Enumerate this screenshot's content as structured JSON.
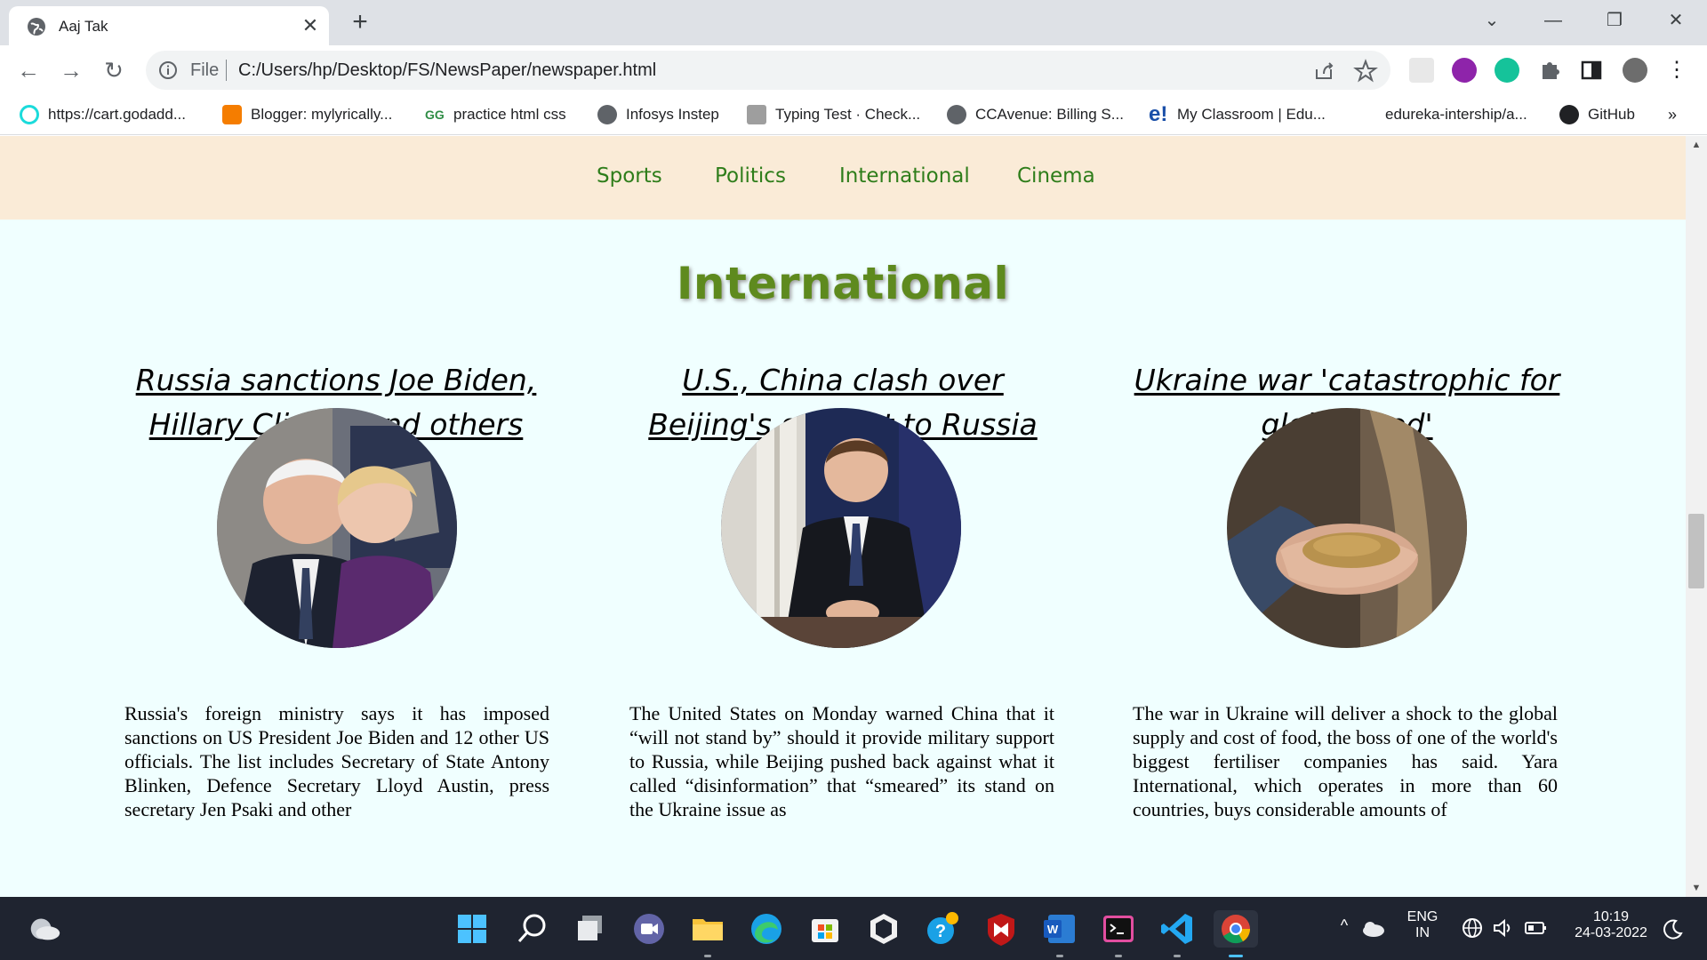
{
  "browser": {
    "tab_title": "Aaj Tak",
    "new_tab_symbol": "+",
    "tab_close_symbol": "✕",
    "scheme_label": "File",
    "url": "C:/Users/hp/Desktop/FS/NewsPaper/newspaper.html",
    "bookmarks": [
      {
        "label": "https://cart.godadd...",
        "icon": "godaddy-icon"
      },
      {
        "label": "Blogger: mylyrically...",
        "icon": "blogger-icon"
      },
      {
        "label": "practice html css",
        "icon": "geeksforgeeks-icon"
      },
      {
        "label": "Infosys Instep",
        "icon": "globe-icon"
      },
      {
        "label": "Typing Test · Check...",
        "icon": "typewriter-icon"
      },
      {
        "label": "CCAvenue: Billing S...",
        "icon": "globe-icon"
      },
      {
        "label": "My Classroom | Edu...",
        "icon": "edureka-icon"
      },
      {
        "label": "edureka-intership/a...",
        "icon": "blank-icon"
      },
      {
        "label": "GitHub",
        "icon": "github-icon"
      }
    ],
    "bookmarks_overflow": "»"
  },
  "page": {
    "nav": [
      "Sports",
      "Politics",
      "International",
      "Cinema"
    ],
    "section_title": "International",
    "articles": [
      {
        "headline": "Russia sanctions Joe Biden, Hillary Clinton and others",
        "image": "biden-clinton-photo",
        "text": "Russia's foreign ministry says it has imposed sanctions on US President Joe Biden and 12 other US officials. The list includes Secretary of State Antony Blinken, Defence Secretary Lloyd Austin, press secretary Jen Psaki and other"
      },
      {
        "headline": "U.S., China clash over Beijing's support to Russia",
        "image": "press-briefing-photo",
        "text": "The United States on Monday warned China that it “will not stand by” should it provide military support to Russia, while Beijing pushed back against what it called “disinformation” that “smeared” its stand on the Ukraine issue as"
      },
      {
        "headline": "Ukraine war 'catastrophic for global food'",
        "image": "grain-in-hand-photo",
        "text": "The war in Ukraine will deliver a shock to the global supply and cost of food, the boss of one of the world's biggest fertiliser companies has said. Yara International, which operates in more than 60 countries, buys considerable amounts of"
      }
    ]
  },
  "taskbar": {
    "language_top": "ENG",
    "language_bottom": "IN",
    "time": "10:19",
    "date": "24-03-2022"
  },
  "colors": {
    "page_bg": "#f0ffff",
    "nav_bg": "#faebd7",
    "nav_link": "#2e7d1a",
    "section_title": "#5e8a1e"
  }
}
